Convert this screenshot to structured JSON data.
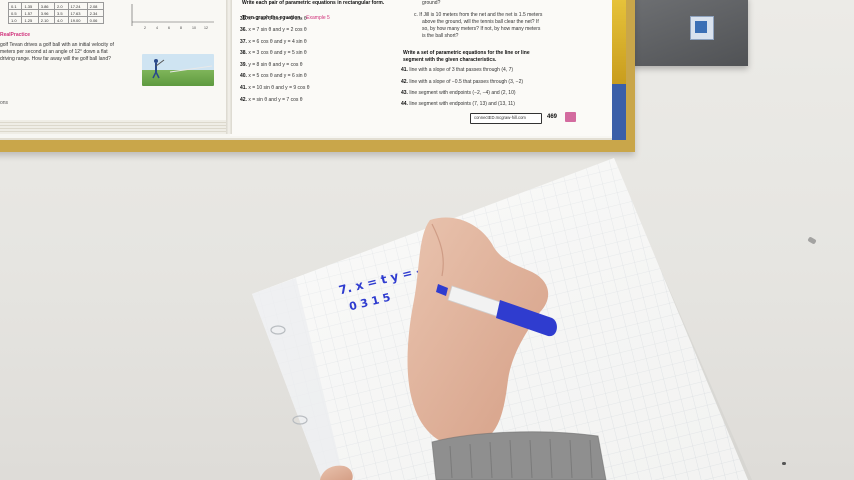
{
  "book": {
    "left_page": {
      "table_rows": [
        [
          "0.1",
          "1.35",
          "3.86",
          "2.0",
          "17.24",
          "2.08"
        ],
        [
          "0.5",
          "1.57",
          "3.96",
          "3.5",
          "17.63",
          "2.34"
        ],
        [
          "1.0",
          "1.25",
          "2.10",
          "4.0",
          "19.00",
          "0.06"
        ]
      ],
      "graph_ticks": [
        "2",
        "4",
        "6",
        "8",
        "10",
        "12"
      ],
      "practice_heading": "RealPractice",
      "practice_text": [
        "golf Tevan drives a golf ball with an initial velocity of",
        "meters per second at an angle of 12° down a flat",
        "driving range. How far away will the golf ball land?"
      ],
      "footer": "ons"
    },
    "right_page": {
      "intro": [
        "Write each pair of parametric equations in rectangular form.",
        "Then graph the equation."
      ],
      "example_ref": "Example 5",
      "exercises": [
        {
          "n": "35.",
          "text": "x = 3 sin θ and y = 3 cos θ"
        },
        {
          "n": "36.",
          "text": "x = 7 sin θ and y = 2 cos θ"
        },
        {
          "n": "37.",
          "text": "x = 6 cos θ and y = 4 sin θ"
        },
        {
          "n": "38.",
          "text": "x = 3 cos θ and y = 5 sin θ"
        },
        {
          "n": "39.",
          "text": "y = 8 sin θ and y = cos θ"
        },
        {
          "n": "40.",
          "text": "x = 5 cos θ and y = 6 sin θ"
        },
        {
          "n": "41.",
          "text": "x = 10 sin θ and y = 9 cos θ"
        },
        {
          "n": "42.",
          "text": "x = sin θ and y = 7 cos θ"
        }
      ],
      "column2_top": [
        "ground?",
        "c. If Jill is 10 meters from the net and the net is 1.5 meters",
        "above the ground, will the tennis ball clear the net? If",
        "so, by how many meters? If not, by how many meters",
        "is the ball short?"
      ],
      "section_heading": [
        "Write a set of parametric equations for the line or line",
        "segment with the given characteristics."
      ],
      "problems": [
        {
          "n": "41.",
          "text": "line with a slope of 3 that passes through (4, 7)"
        },
        {
          "n": "42.",
          "text": "line with a slope of −0.5 that passes through (3, −2)"
        },
        {
          "n": "43.",
          "text": "line segment with endpoints (−2, −4) and (2, 10)"
        },
        {
          "n": "44.",
          "text": "line segment with endpoints (7, 13) and (13, 11)"
        }
      ],
      "sticky_text": "connectED.mcgraw-hill.com",
      "page_number": "469"
    }
  },
  "whiteboard": {
    "handwriting_line1": "7. x = t    y = -√t",
    "handwriting_line2": "0  3  1  5"
  },
  "colors": {
    "marker_blue": "#2f3ccf",
    "book_spine_gold": "#c9a64a",
    "sleeve_white": "#f8f8f6",
    "grid_line": "#c8cfd6"
  }
}
